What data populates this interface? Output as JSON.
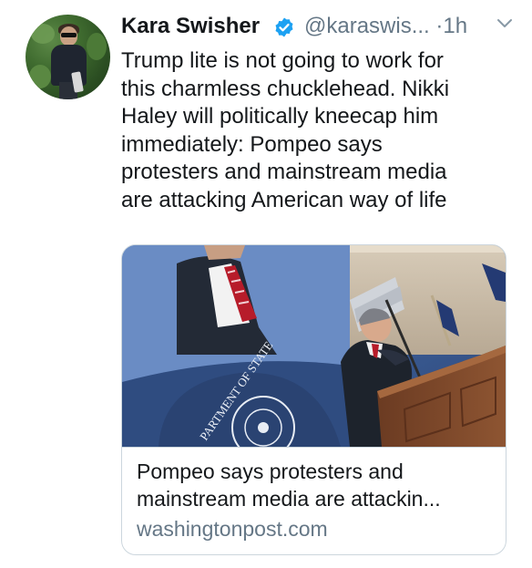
{
  "tweet": {
    "author_name": "Kara Swisher",
    "handle_time": "@karaswis... ·1h",
    "text_lines": [
      "Trump lite is not going to work for",
      "this charmless chucklehead. Nikki",
      "Haley will politically kneecap him",
      "immediately: Pompeo says",
      "protesters and mainstream media",
      "are attacking American way of life"
    ]
  },
  "card": {
    "title_lines": [
      "Pompeo says protesters and",
      "mainstream media are attackin..."
    ],
    "domain": "washingtonpost.com",
    "seal_text": "PARTMENT OF STATE"
  },
  "icons": {
    "verified": "verified-badge-icon",
    "menu": "chevron-down-icon"
  },
  "colors": {
    "text": "#14171a",
    "secondary": "#657786",
    "verified": "#1da1f2",
    "border": "#ccd6dd"
  }
}
